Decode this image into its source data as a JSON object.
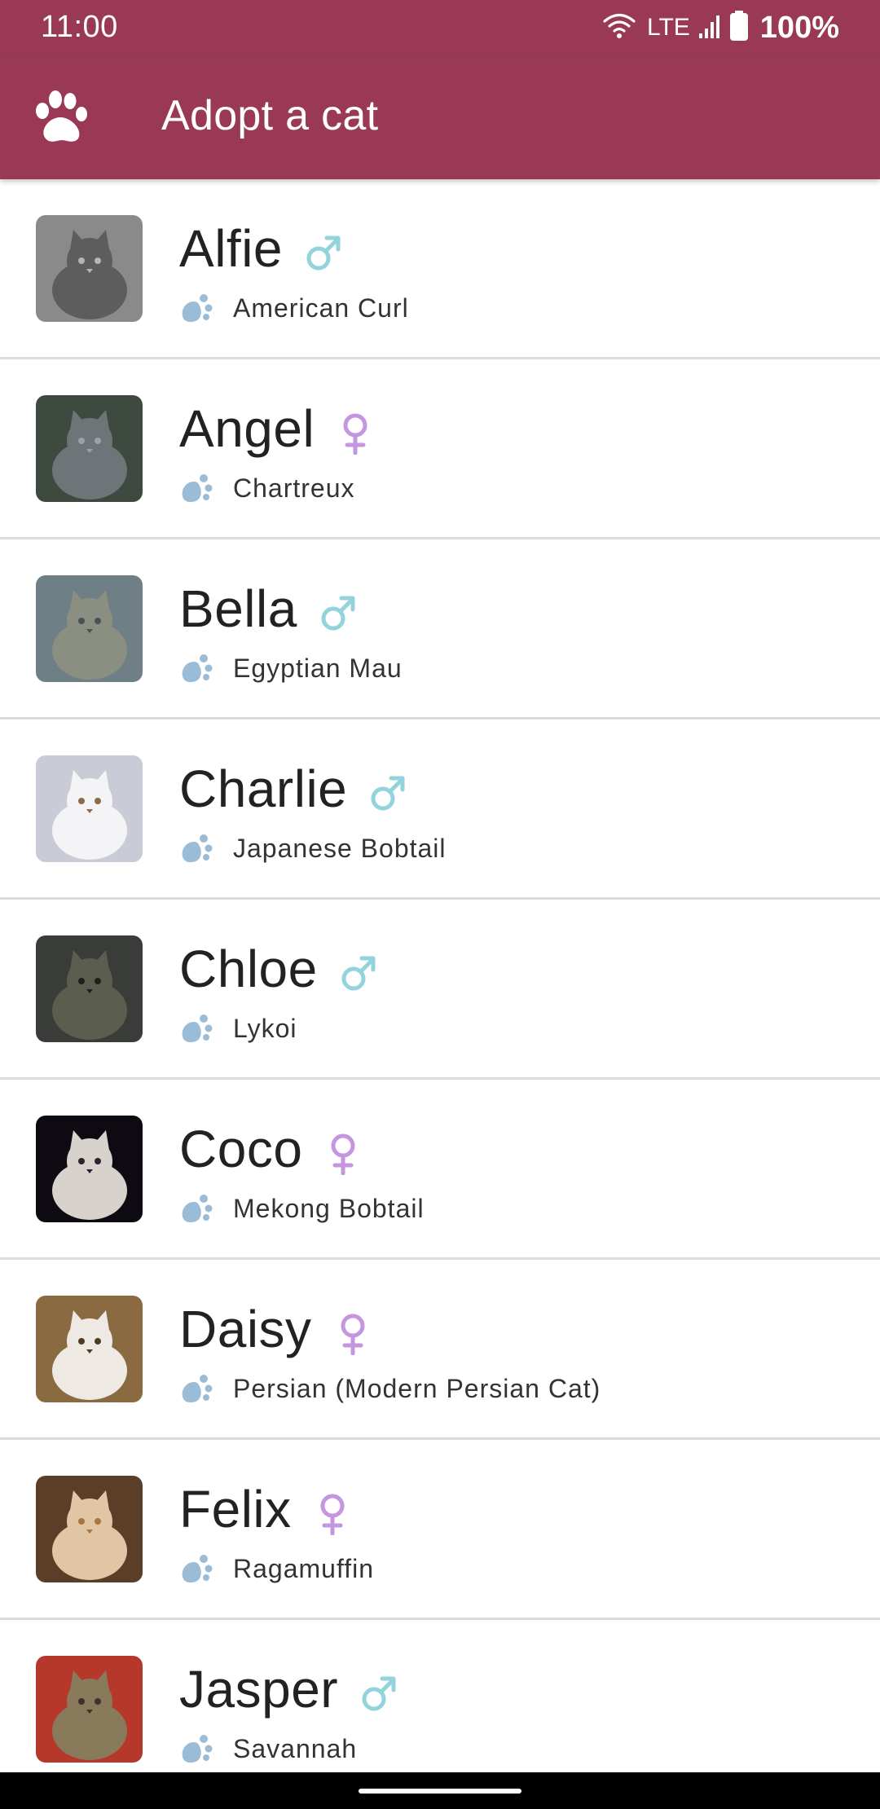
{
  "status_bar": {
    "time": "11:00",
    "network": "LTE",
    "battery": "100%",
    "icons": [
      "wifi-icon",
      "signal-icon",
      "battery-icon"
    ]
  },
  "app_bar": {
    "title": "Adopt a cat",
    "logo_icon": "paw-icon",
    "background_color": "#993955"
  },
  "colors": {
    "male": "#93d3db",
    "female": "#c596e0",
    "paw": "#9bbcd6",
    "divider": "#dcdcdc"
  },
  "cats": [
    {
      "name": "Alfie",
      "gender": "male",
      "gender_icon": "male-icon",
      "breed": "American Curl"
    },
    {
      "name": "Angel",
      "gender": "female",
      "gender_icon": "female-icon",
      "breed": "Chartreux"
    },
    {
      "name": "Bella",
      "gender": "male",
      "gender_icon": "male-icon",
      "breed": "Egyptian Mau"
    },
    {
      "name": "Charlie",
      "gender": "male",
      "gender_icon": "male-icon",
      "breed": "Japanese Bobtail"
    },
    {
      "name": "Chloe",
      "gender": "male",
      "gender_icon": "male-icon",
      "breed": "Lykoi"
    },
    {
      "name": "Coco",
      "gender": "female",
      "gender_icon": "female-icon",
      "breed": "Mekong Bobtail"
    },
    {
      "name": "Daisy",
      "gender": "female",
      "gender_icon": "female-icon",
      "breed": "Persian (Modern Persian Cat)"
    },
    {
      "name": "Felix",
      "gender": "female",
      "gender_icon": "female-icon",
      "breed": "Ragamuffin"
    },
    {
      "name": "Jasper",
      "gender": "male",
      "gender_icon": "male-icon",
      "breed": "Savannah"
    }
  ]
}
